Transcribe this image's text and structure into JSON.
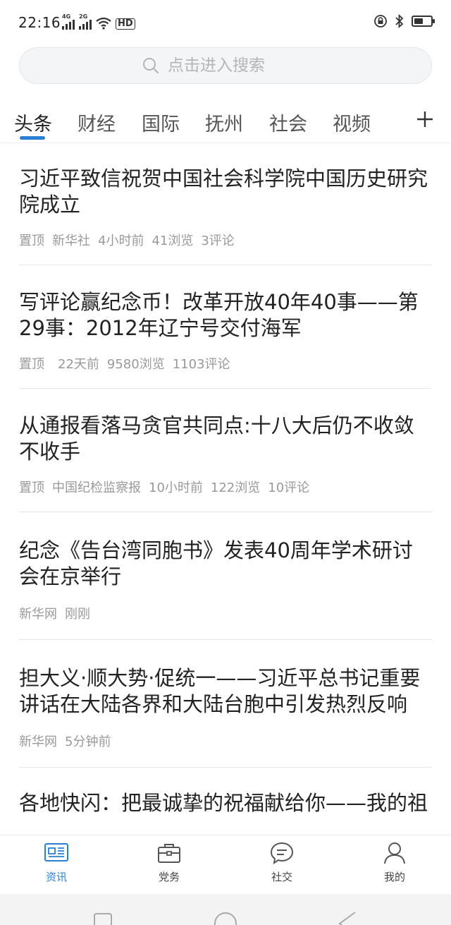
{
  "status": {
    "time": "22:16",
    "net1": "4G",
    "net2": "2G",
    "hd": "HD"
  },
  "search": {
    "placeholder": "点击进入搜索"
  },
  "tabs": [
    {
      "label": "头条",
      "active": true
    },
    {
      "label": "财经"
    },
    {
      "label": "国际"
    },
    {
      "label": "抚州"
    },
    {
      "label": "社会"
    },
    {
      "label": "视频"
    }
  ],
  "accent": "#2a7fd4",
  "pin_color": "#c9463d",
  "news": [
    {
      "title": "习近平致信祝贺中国社会科学院中国历史研究院成立",
      "pin": "置顶",
      "source": "新华社",
      "time": "4小时前",
      "views": "41浏览",
      "comments": "3评论"
    },
    {
      "title": "写评论赢纪念币！改革开放40年40事——第29事：2012年辽宁号交付海军",
      "pin": "置顶",
      "source": "",
      "time": "22天前",
      "views": "9580浏览",
      "comments": "1103评论"
    },
    {
      "title": "从通报看落马贪官共同点:十八大后仍不收敛不收手",
      "pin": "置顶",
      "source": "中国纪检监察报",
      "time": "10小时前",
      "views": "122浏览",
      "comments": "10评论"
    },
    {
      "title": "纪念《告台湾同胞书》发表40周年学术研讨会在京举行",
      "pin": "",
      "source": "新华网",
      "time": "刚刚",
      "views": "",
      "comments": ""
    },
    {
      "title": "担大义·顺大势·促统一——习近平总书记重要讲话在大陆各界和大陆台胞中引发热烈反响",
      "pin": "",
      "source": "新华网",
      "time": "5分钟前",
      "views": "",
      "comments": ""
    },
    {
      "title": "各地快闪：把最诚挚的祝福献给你——我的祖",
      "pin": "",
      "source": "",
      "time": "",
      "views": "",
      "comments": ""
    }
  ],
  "bottomnav": [
    {
      "label": "资讯",
      "icon": "news-icon",
      "active": true
    },
    {
      "label": "党务",
      "icon": "briefcase-icon"
    },
    {
      "label": "社交",
      "icon": "chat-icon"
    },
    {
      "label": "我的",
      "icon": "person-icon"
    }
  ]
}
